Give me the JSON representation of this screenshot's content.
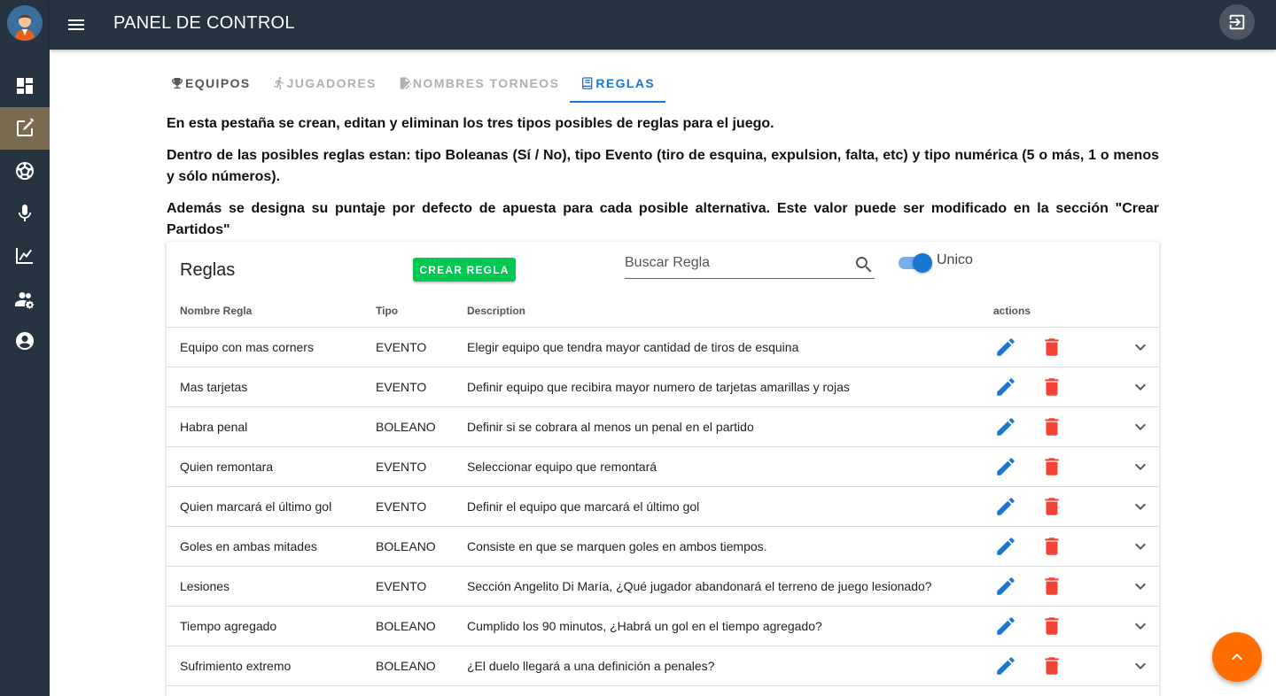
{
  "header": {
    "title": "PANEL DE CONTROL",
    "menu_icon": "menu-icon",
    "logout_icon": "logout-icon"
  },
  "sidebar": {
    "avatar_icon": "user-avatar",
    "items": [
      {
        "icon": "dashboard-icon",
        "active": false
      },
      {
        "icon": "edit-note-icon",
        "active": true
      },
      {
        "icon": "soccer-ball-icon",
        "active": false
      },
      {
        "icon": "microphone-icon",
        "active": false
      },
      {
        "icon": "stats-chart-icon",
        "active": false
      },
      {
        "icon": "users-settings-icon",
        "active": false
      },
      {
        "icon": "account-circle-icon",
        "active": false
      }
    ]
  },
  "tabs": [
    {
      "label": "EQUIPOS",
      "icon": "trophy-icon"
    },
    {
      "label": "JUGADORES",
      "icon": "runner-icon"
    },
    {
      "label": "NOMBRES TORNEOS",
      "icon": "edit-document-icon"
    },
    {
      "label": "REGLAS",
      "icon": "rules-book-icon"
    }
  ],
  "active_tab": "REGLAS",
  "intro": {
    "p1": "En esta pestaña se crean, editan y eliminan los tres tipos posibles de reglas para el juego.",
    "p2": "Dentro de las posibles reglas estan: tipo Boleanas (Sí / No), tipo Evento (tiro de esquina, expulsion, falta, etc) y tipo numérica (5 o más, 1 o menos y sólo números).",
    "p3": "Además se designa su puntaje por defecto de apuesta para cada posible alternativa. Este valor puede ser modificado en la sección \"Crear Partidos\""
  },
  "card": {
    "title": "Reglas",
    "create_button": "CREAR REGLA",
    "search_placeholder": "Buscar Regla",
    "search_value": "",
    "toggle_label": "Unico",
    "toggle_on": true
  },
  "table": {
    "columns": [
      "Nombre Regla",
      "Tipo",
      "Description",
      "actions"
    ],
    "rows": [
      {
        "name": "Equipo con mas corners",
        "type": "EVENTO",
        "description": "Elegir equipo que tendra mayor cantidad de tiros de esquina"
      },
      {
        "name": "Mas tarjetas",
        "type": "EVENTO",
        "description": "Definir equipo que recibira mayor numero de tarjetas amarillas y rojas"
      },
      {
        "name": "Habra penal",
        "type": "BOLEANO",
        "description": "Definir si se cobrara al menos un penal en el partido"
      },
      {
        "name": "Quien remontara",
        "type": "EVENTO",
        "description": "Seleccionar equipo que remontará"
      },
      {
        "name": "Quien marcará el último gol",
        "type": "EVENTO",
        "description": "Definir el equipo que marcará el último gol"
      },
      {
        "name": "Goles en ambas mitades",
        "type": "BOLEANO",
        "description": "Consiste en que se marquen goles en ambos tiempos."
      },
      {
        "name": "Lesiones",
        "type": "EVENTO",
        "description": "Sección Angelito Di María, ¿Qué jugador abandonará el terreno de juego lesionado?"
      },
      {
        "name": "Tiempo agregado",
        "type": "BOLEANO",
        "description": "Cumplido los 90 minutos, ¿Habrá un gol en el tiempo agregado?"
      },
      {
        "name": "Sufrimiento extremo",
        "type": "BOLEANO",
        "description": "¿El duelo llegará a una definición a penales?"
      },
      {
        "name": "",
        "type": "",
        "description": ""
      }
    ]
  },
  "fab_icon": "chevron-up-icon",
  "colors": {
    "nav_bg": "#263442",
    "active_nav": "#7a6a4f",
    "accent_blue": "#1976d2",
    "create_green": "#00c853",
    "delete_red": "#f44336",
    "fab_orange": "#ff6d00"
  }
}
